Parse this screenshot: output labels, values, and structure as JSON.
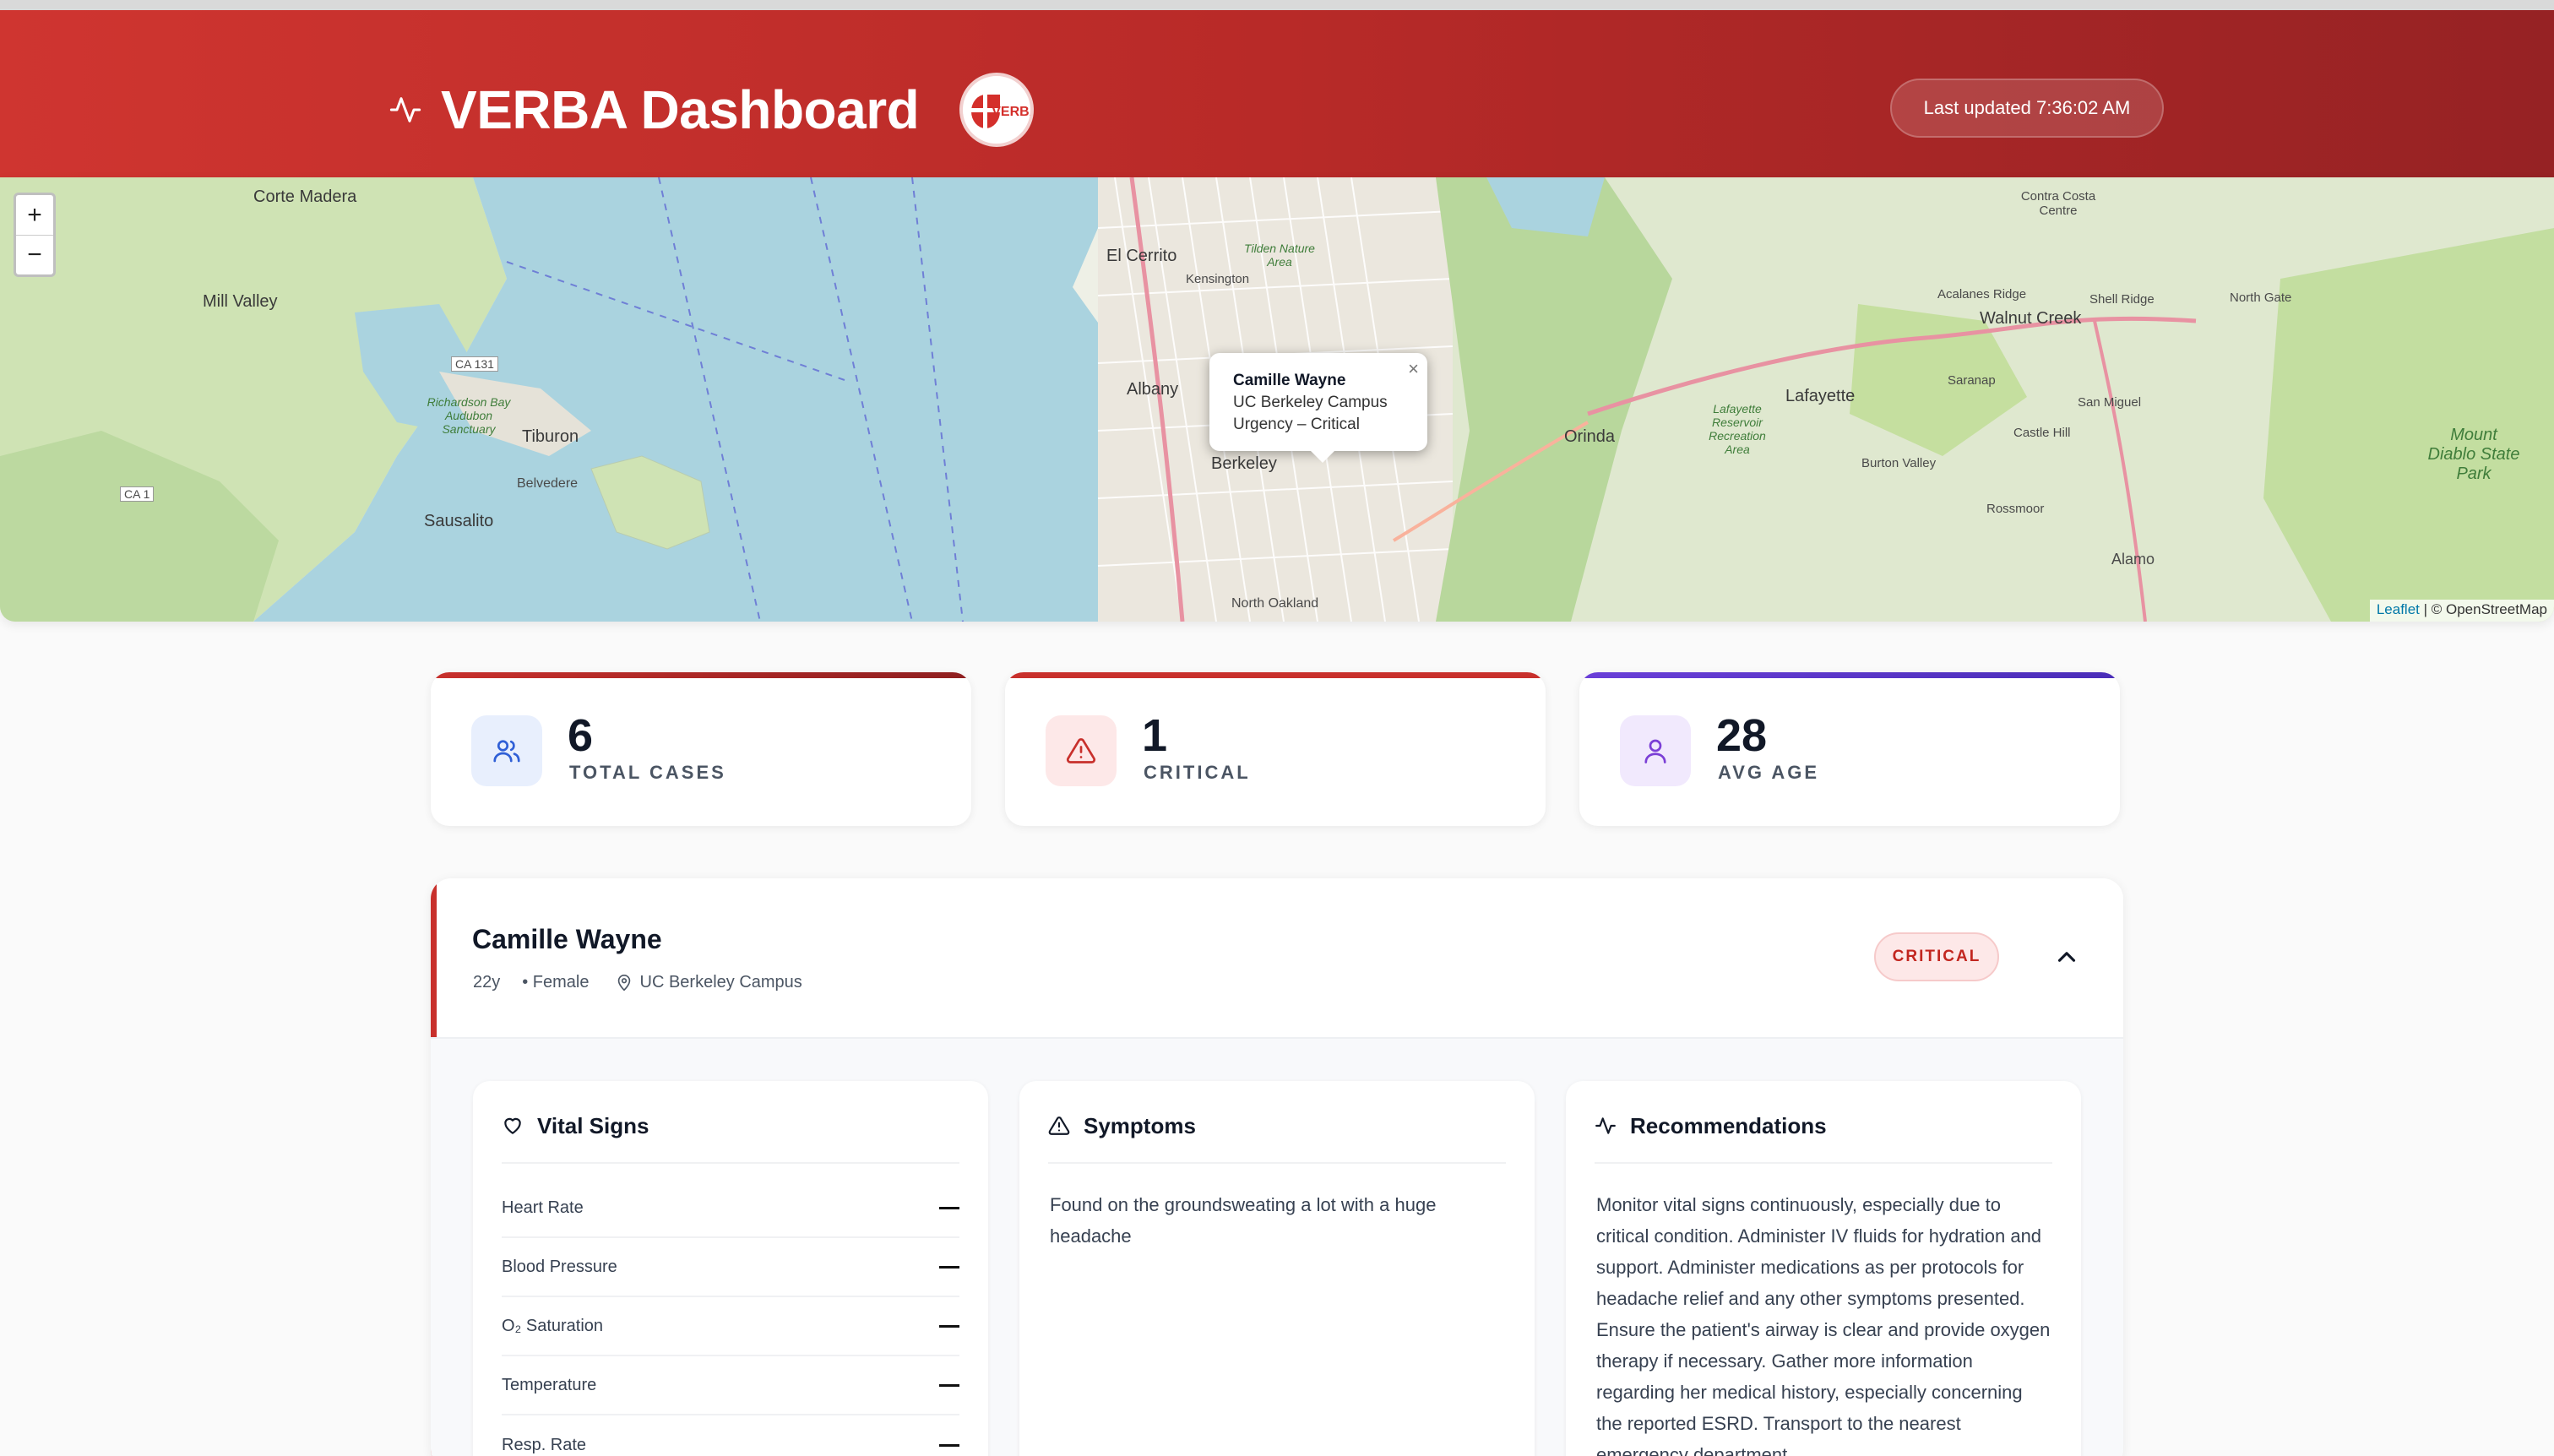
{
  "header": {
    "title": "VERBA Dashboard",
    "logo_text": "VERBA",
    "last_updated": "Last updated 7:36:02 AM"
  },
  "map": {
    "zoom_in": "+",
    "zoom_out": "−",
    "places": [
      "Corte Madera",
      "Mill Valley",
      "Tiburon",
      "Belvedere",
      "Sausalito",
      "El Cerrito",
      "Kensington",
      "Albany",
      "Berkeley",
      "North Oakland",
      "Orinda",
      "Lafayette",
      "Walnut Creek",
      "Contra Costa Centre",
      "Acalanes Ridge",
      "Shell Ridge",
      "North Gate",
      "Saranap",
      "San Miguel",
      "Castle Hill",
      "Burton Valley",
      "Rossmoor",
      "Alamo",
      "Mount Diablo State Park",
      "CA 131",
      "CA 1",
      "Richardson Bay Audubon Sanctuary",
      "Lafayette Reservoir Recreation Area",
      "Tilden Nature Area"
    ],
    "popup": {
      "name": "Camille Wayne",
      "location": "UC Berkeley Campus",
      "urgency": "Urgency – Critical",
      "close": "×"
    },
    "attribution_leaflet": "Leaflet",
    "attribution_osm": " | © OpenStreetMap"
  },
  "stats": [
    {
      "value": "6",
      "label": "TOTAL CASES",
      "icon": "users-icon",
      "bar_color": "#b92c27",
      "icon_bg": "#e8effd",
      "icon_color": "#2f5fd6"
    },
    {
      "value": "1",
      "label": "CRITICAL",
      "icon": "alert-triangle-icon",
      "bar_color": "#c8302c",
      "icon_bg": "#fde8e8",
      "icon_color": "#c8302c"
    },
    {
      "value": "28",
      "label": "AVG AGE",
      "icon": "user-icon",
      "bar_color": "#6a3fd8",
      "icon_bg": "#f1e9fd",
      "icon_color": "#7b3fd6"
    }
  ],
  "case": {
    "name": "Camille Wayne",
    "age": "22y",
    "gender": "• Female",
    "location": "UC Berkeley Campus",
    "status": "CRITICAL",
    "vitals_title": "Vital Signs",
    "vitals": [
      {
        "label": "Heart Rate",
        "value": "—"
      },
      {
        "label": "Blood Pressure",
        "value": "—"
      },
      {
        "label": "O₂ Saturation",
        "value": "—"
      },
      {
        "label": "Temperature",
        "value": "—"
      },
      {
        "label": "Resp. Rate",
        "value": "—"
      }
    ],
    "symptoms_title": "Symptoms",
    "symptoms_text": "Found on the groundsweating a lot with a huge headache",
    "recommendations_title": "Recommendations",
    "recommendations_text": "Monitor vital signs continuously, especially due to critical condition. Administer IV fluids for hydration and support. Administer medications as per protocols for headache relief and any other symptoms presented. Ensure the patient's airway is clear and provide oxygen therapy if necessary. Gather more information regarding her medical history, especially concerning the reported ESRD. Transport to the nearest emergency department"
  }
}
